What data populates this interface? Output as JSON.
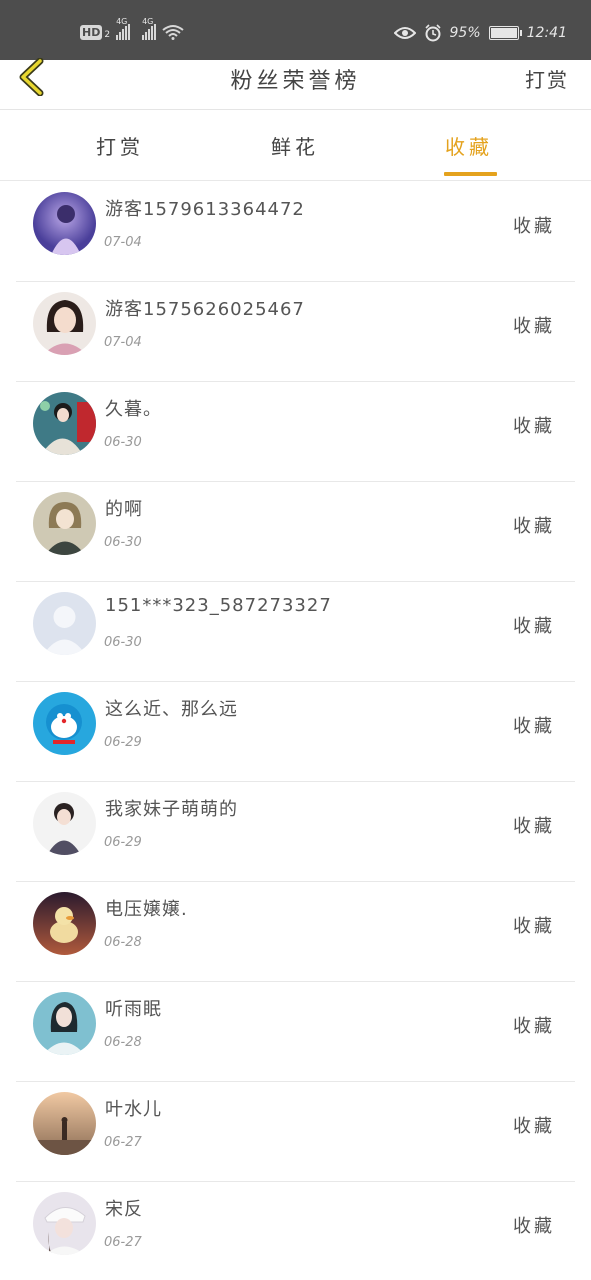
{
  "status_bar": {
    "hd_label": "HD",
    "sim_number": "2",
    "network1": "4G",
    "network2": "4G",
    "battery_percent": "95%",
    "battery_level": 0.95,
    "time": "12:41"
  },
  "header": {
    "title": "粉丝荣誉榜",
    "right_action": "打赏"
  },
  "tabs": [
    {
      "label": "打赏",
      "active": false
    },
    {
      "label": "鲜花",
      "active": false
    },
    {
      "label": "收藏",
      "active": true
    }
  ],
  "accent_color": "#e4a21d",
  "fans": [
    {
      "name": "游客1579613364472",
      "date": "07-04",
      "action": "收藏",
      "avatar": "purple-portrait"
    },
    {
      "name": "游客1575626025467",
      "date": "07-04",
      "action": "收藏",
      "avatar": "girl-portrait"
    },
    {
      "name": "久暮。",
      "date": "06-30",
      "action": "收藏",
      "avatar": "colorful-portrait"
    },
    {
      "name": "的啊",
      "date": "06-30",
      "action": "收藏",
      "avatar": "anime-girl"
    },
    {
      "name": "151***323_587273327",
      "date": "06-30",
      "action": "收藏",
      "avatar": "default-avatar"
    },
    {
      "name": "这么近、那么远",
      "date": "06-29",
      "action": "收藏",
      "avatar": "doraemon"
    },
    {
      "name": "我家妹子萌萌的",
      "date": "06-29",
      "action": "收藏",
      "avatar": "little-girl"
    },
    {
      "name": "电压嬢嬢.",
      "date": "06-28",
      "action": "收藏",
      "avatar": "yellow-duck"
    },
    {
      "name": "听雨眠",
      "date": "06-28",
      "action": "收藏",
      "avatar": "blue-portrait"
    },
    {
      "name": "叶水儿",
      "date": "06-27",
      "action": "收藏",
      "avatar": "sunset-scene"
    },
    {
      "name": "宋反",
      "date": "06-27",
      "action": "收藏",
      "avatar": "white-hat-girl"
    }
  ]
}
